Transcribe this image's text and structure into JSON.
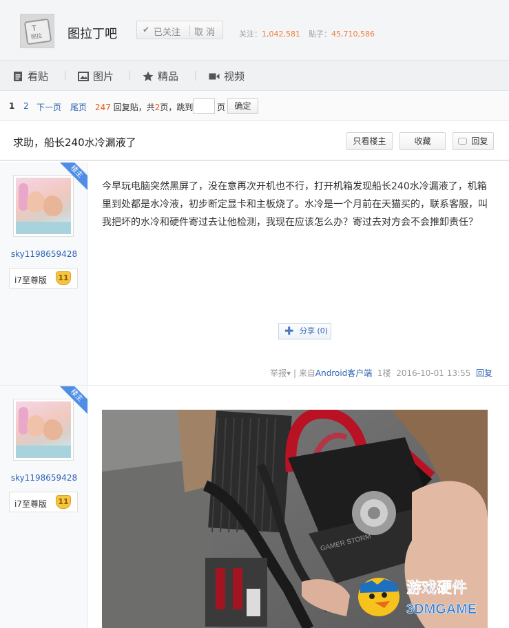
{
  "forum": {
    "avatar_text_top": "T",
    "avatar_text_bottom": "图拉",
    "name": "图拉丁吧",
    "follow_label": "已关注",
    "cancel_label": "取 消",
    "members_label": "关注：",
    "members_count": "1,042,581",
    "posts_label": "贴子：",
    "posts_count": "45,710,586"
  },
  "nav": {
    "items": [
      {
        "label": "看贴",
        "icon": "document-icon"
      },
      {
        "label": "图片",
        "icon": "image-icon"
      },
      {
        "label": "精品",
        "icon": "star-icon"
      },
      {
        "label": "视频",
        "icon": "video-icon"
      }
    ]
  },
  "pager": {
    "pages": [
      "1",
      "2"
    ],
    "next_label": "下一页",
    "last_label": "尾页",
    "reply_count": "247",
    "reply_suffix": "回复贴，共",
    "page_total": "2",
    "page_suffix": "页，跳到",
    "unit": "页",
    "jump_value": "",
    "ok_label": "确定"
  },
  "thread": {
    "title": "求助，船长240水冷漏液了",
    "only_op_label": "只看楼主",
    "favorite_label": "收藏",
    "reply_label": "回复"
  },
  "posts": [
    {
      "badge": "楼主",
      "username": "sky1198659428",
      "rank_title": "i7至尊版",
      "level": "11",
      "content": "今早玩电脑突然黑屏了，没在意再次开机也不行，打开机箱发现船长240水冷漏液了，机箱里到处都是水冷液，初步断定显卡和主板烧了。水冷是一个月前在天猫买的，联系客服，叫我把坏的水冷和硬件寄过去让他检测，我现在应该怎么办？寄过去对方会不会推卸责任？",
      "share_label": "分享",
      "share_count": "(0)",
      "report_label": "举报",
      "source_prefix": "| 来自",
      "source": "Android客户端",
      "floor": "1楼",
      "time": "2016-10-01 13:55",
      "reply_label": "回复"
    },
    {
      "badge": "楼主",
      "username": "sky1198659428",
      "rank_title": "i7至尊版",
      "level": "11"
    }
  ],
  "photo": {
    "brand_text": "GAMER STORM"
  },
  "watermark": {
    "line1": "游戏硬件",
    "line2": "3DMGAME"
  },
  "colors": {
    "link": "#2d64b3",
    "accent_orange": "#ee7d3b",
    "badge_blue": "#4f8ee6"
  }
}
